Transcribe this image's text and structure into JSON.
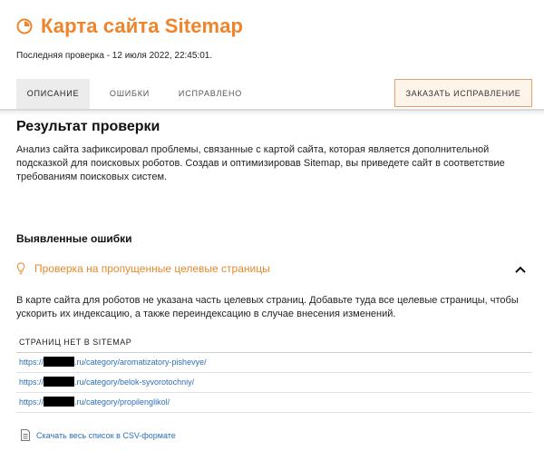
{
  "header": {
    "title": "Карта сайта Sitemap",
    "last_check": "Последняя проверка - 12 июля 2022, 22:45:01."
  },
  "tabs": [
    {
      "label": "ОПИСАНИЕ",
      "active": true
    },
    {
      "label": "ОШИБКИ",
      "active": false
    },
    {
      "label": "ИСПРАВЛЕНО",
      "active": false
    }
  ],
  "order_button": {
    "label": "ЗАКАЗАТЬ ИСПРАВЛЕНИЕ"
  },
  "result": {
    "title": "Результат проверки",
    "description": "Анализ сайта зафиксировал проблемы, связанные с картой сайта, которая является дополнительной подсказкой для поисковых роботов. Создав и оптимизировав Sitemap, вы приведете сайт в соответствие требованиям поисковых систем."
  },
  "errors": {
    "title": "Выявленные ошибки",
    "check": {
      "title": "Проверка на пропущенные целевые страницы",
      "expanded": true,
      "description": "В карте сайта для роботов не указана часть целевых страниц. Добавьте туда все целевые страницы, чтобы ускорить их индексацию, а также переиндексацию в случае внесения изменений.",
      "table_header": "СТРАНИЦ НЕТ В SITEMAP",
      "rows": [
        {
          "prefix": "https://",
          "suffix": ".ru/category/aromatizatory-pishevye/"
        },
        {
          "prefix": "https://",
          "suffix": ".ru/category/belok-syvorotochniy/"
        },
        {
          "prefix": "https://",
          "suffix": ".ru/category/propilenglikol/"
        }
      ],
      "download_link": "Скачать весь список в CSV-формате"
    }
  },
  "colors": {
    "accent": "#f0842b",
    "link": "#2c6fb6",
    "button_border": "#e3a170",
    "button_bg": "#fff4ea",
    "active_tab_bg": "#ececec"
  },
  "icons": {
    "title": "pie-chart-icon",
    "check": "lightbulb-icon",
    "toggle": "chevron-up-icon",
    "download": "spreadsheet-file-icon"
  }
}
